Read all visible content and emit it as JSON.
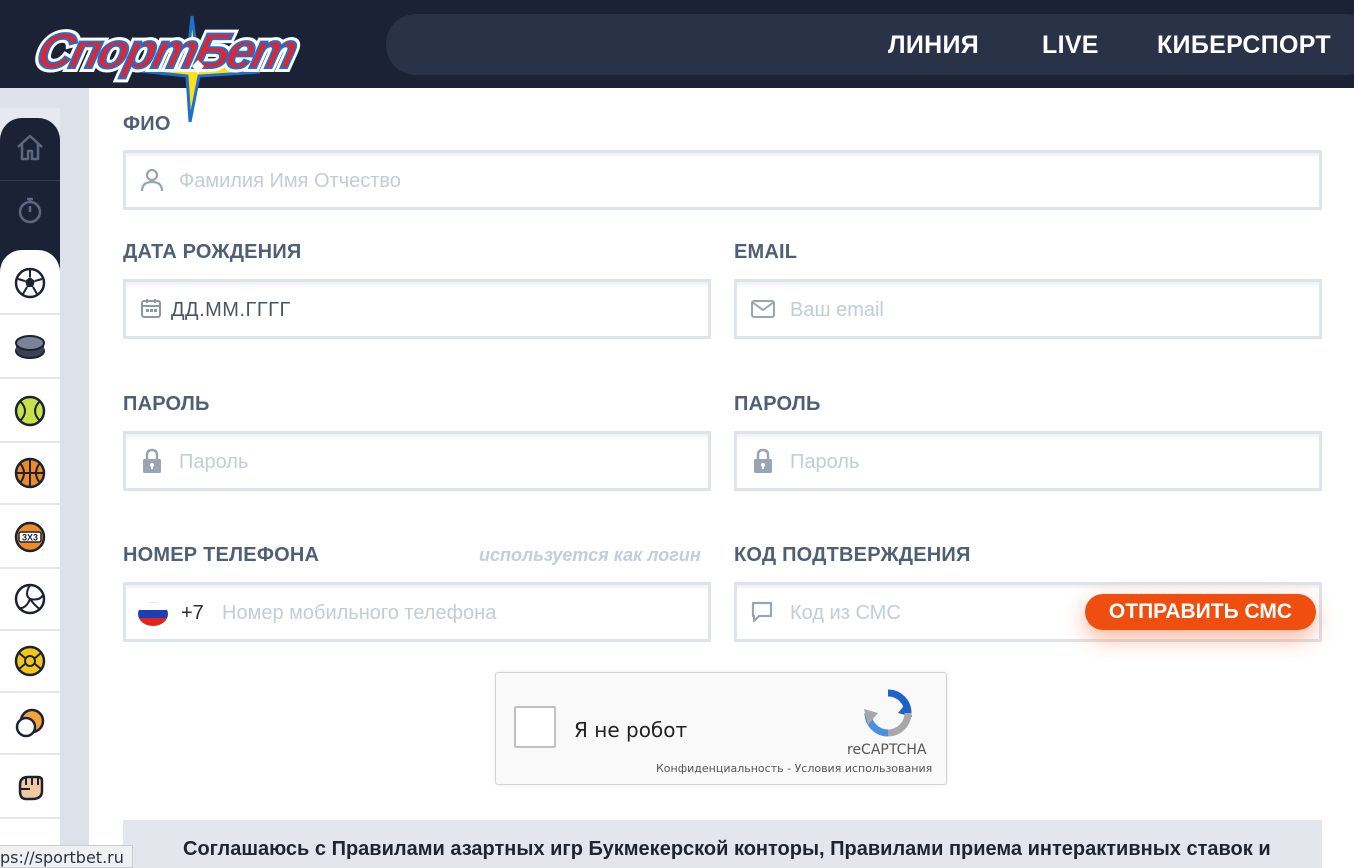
{
  "brand": {
    "logo_text": "СпортБет",
    "colors": {
      "red": "#e5232b",
      "blue": "#1f6fd0",
      "yellow": "#ffe018",
      "dark": "#1b2235",
      "accent": "#ef4e0f"
    }
  },
  "nav": {
    "items": [
      {
        "label": "ЛИНИЯ"
      },
      {
        "label": "LIVE"
      },
      {
        "label": "КИБЕРСПОРТ"
      }
    ]
  },
  "sidebar": {
    "top_icons": [
      "home-icon",
      "stopwatch-icon"
    ],
    "sport_icons": [
      "soccer-ball-icon",
      "hockey-puck-icon",
      "tennis-ball-icon",
      "basketball-icon",
      "basketball-3x3-icon",
      "volleyball-icon",
      "handball-icon",
      "boxing-icon",
      "fist-icon",
      "more-sport-icon"
    ]
  },
  "form": {
    "fio": {
      "label": "ФИО",
      "placeholder": "Фамилия Имя Отчество",
      "icon": "user-icon"
    },
    "birthdate": {
      "label": "ДАТА РОЖДЕНИЯ",
      "value": "ДД.ММ.ГГГГ",
      "icon": "calendar-icon"
    },
    "email": {
      "label": "EMAIL",
      "placeholder": "Ваш email",
      "icon": "envelope-icon"
    },
    "password": {
      "label": "ПАРОЛЬ",
      "placeholder": "Пароль",
      "icon": "lock-icon"
    },
    "password_confirm": {
      "label": "ПАРОЛЬ",
      "placeholder": "Пароль",
      "icon": "lock-icon"
    },
    "phone": {
      "label": "НОМЕР ТЕЛЕФОНА",
      "hint": "используется как логин",
      "code": "+7",
      "placeholder": "Номер мобильного телефона",
      "icon": "russia-flag-icon"
    },
    "sms_code": {
      "label": "КОД ПОДТВЕРЖДЕНИЯ",
      "placeholder": "Код из СМС",
      "icon": "chat-bubble-icon",
      "button": "ОТПРАВИТЬ СМС"
    }
  },
  "recaptcha": {
    "label": "Я не робот",
    "brand": "reCAPTCHA",
    "links": "Конфиденциальность - Условия использования"
  },
  "agreement": {
    "text": "Соглашаюсь с Правилами азартных игр Букмекерской конторы, Правилами приема интерактивных ставок и"
  },
  "status_bar": {
    "url": "ps://sportbet.ru"
  }
}
